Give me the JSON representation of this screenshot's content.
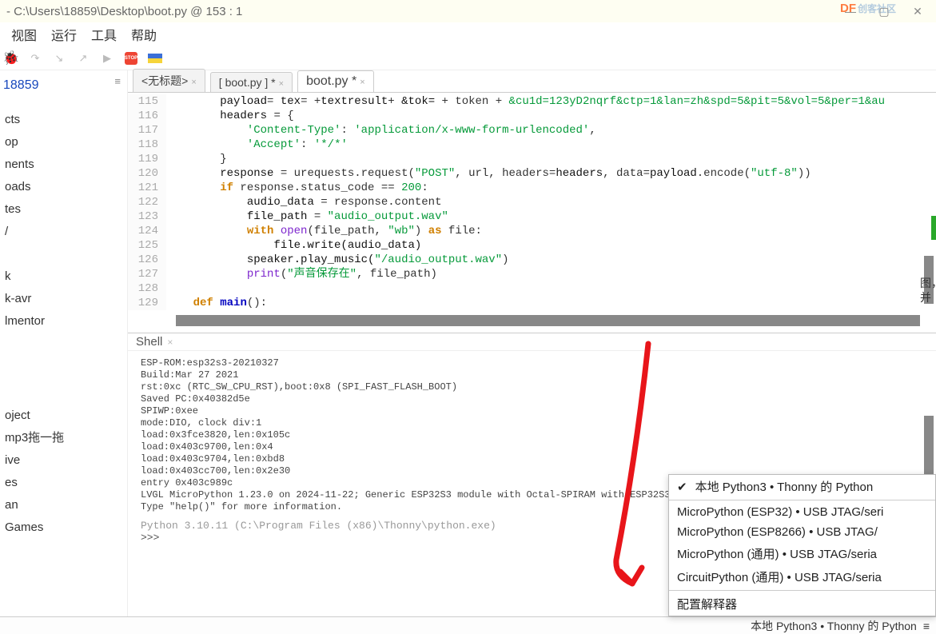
{
  "title": "- C:\\Users\\18859\\Desktop\\boot.py  @  153 : 1",
  "window": {
    "min": "—",
    "max": "▢",
    "close": "✕"
  },
  "df_brand": {
    "text": "DF",
    "sub": "创客社区"
  },
  "menu": {
    "view": "视图",
    "run": "运行",
    "tools": "工具",
    "help": "帮助"
  },
  "tabs": {
    "t1": "<无标题>",
    "t2": "[ boot.py ] *",
    "t3": "boot.py *"
  },
  "sidebar": {
    "root": "18859",
    "items": [
      "cts",
      "op",
      "nents",
      "oads",
      "tes",
      "/",
      "k",
      "k-avr",
      "lmentor",
      "oject",
      "mp3拖一拖",
      "ive",
      "es",
      "an",
      "Games"
    ]
  },
  "code": {
    "lines": [
      {
        "n": "115",
        "ind": "        ",
        "seg": [
          [
            "nm",
            "payload"
          ],
          [
            "op",
            "= "
          ],
          [
            "nm",
            "tex"
          ],
          [
            "op",
            "= +"
          ],
          [
            "nm",
            "textresult"
          ],
          [
            "op",
            "+ "
          ],
          [
            "nm",
            "&tok="
          ],
          [
            "op",
            " + token + "
          ],
          [
            "str",
            "&cu1d=123yD2nqrf&ctp=1&lan=zh&spd=5&pit=5&vol=5&per=1&au"
          ]
        ]
      },
      {
        "n": "116",
        "ind": "        ",
        "seg": [
          [
            "nm",
            "headers "
          ],
          [
            "op",
            "= {"
          ]
        ]
      },
      {
        "n": "117",
        "ind": "            ",
        "seg": [
          [
            "str",
            "'Content-Type'"
          ],
          [
            "op",
            ": "
          ],
          [
            "str",
            "'application/x-www-form-urlencoded'"
          ],
          [
            "op",
            ","
          ]
        ]
      },
      {
        "n": "118",
        "ind": "            ",
        "seg": [
          [
            "str",
            "'Accept'"
          ],
          [
            "op",
            ": "
          ],
          [
            "str",
            "'*/*'"
          ]
        ]
      },
      {
        "n": "119",
        "ind": "        ",
        "seg": [
          [
            "op",
            "}"
          ]
        ]
      },
      {
        "n": "120",
        "ind": "        ",
        "seg": [
          [
            "nm",
            "response "
          ],
          [
            "op",
            "= urequests.request("
          ],
          [
            "str",
            "\"POST\""
          ],
          [
            "op",
            ", url, headers"
          ],
          [
            "op",
            "="
          ],
          [
            "nm",
            "headers"
          ],
          [
            "op",
            ", data"
          ],
          [
            "op",
            "="
          ],
          [
            "nm",
            "payload"
          ],
          [
            "op",
            ".encode("
          ],
          [
            "str",
            "\"utf-8\""
          ],
          [
            "op",
            "))"
          ]
        ]
      },
      {
        "n": "121",
        "ind": "        ",
        "seg": [
          [
            "kw2",
            "if"
          ],
          [
            "op",
            " response.status_code "
          ],
          [
            "op",
            "== "
          ],
          [
            "num",
            "200"
          ],
          [
            "op",
            ":"
          ]
        ]
      },
      {
        "n": "122",
        "ind": "            ",
        "seg": [
          [
            "nm",
            "audio_data "
          ],
          [
            "op",
            "= response.content"
          ]
        ]
      },
      {
        "n": "123",
        "ind": "            ",
        "seg": [
          [
            "nm",
            "file_path "
          ],
          [
            "op",
            "= "
          ],
          [
            "str",
            "\"audio_output.wav\""
          ]
        ]
      },
      {
        "n": "124",
        "ind": "            ",
        "seg": [
          [
            "kw2",
            "with"
          ],
          [
            "op",
            " "
          ],
          [
            "fn",
            "open"
          ],
          [
            "op",
            "(file_path, "
          ],
          [
            "str",
            "\"wb\""
          ],
          [
            "op",
            ") "
          ],
          [
            "kw2",
            "as"
          ],
          [
            "op",
            " file:"
          ]
        ]
      },
      {
        "n": "125",
        "ind": "                ",
        "seg": [
          [
            "nm",
            "file.write(audio_data)"
          ]
        ]
      },
      {
        "n": "126",
        "ind": "            ",
        "seg": [
          [
            "nm",
            "speaker.play_music("
          ],
          [
            "str",
            "\"/audio_output.wav\""
          ],
          [
            "op",
            ")"
          ]
        ]
      },
      {
        "n": "127",
        "ind": "            ",
        "seg": [
          [
            "fn",
            "print"
          ],
          [
            "op",
            "("
          ],
          [
            "str",
            "\"声音保存在\""
          ],
          [
            "op",
            ", file_path)"
          ]
        ]
      },
      {
        "n": "128",
        "ind": "",
        "seg": []
      },
      {
        "n": "129",
        "ind": "    ",
        "seg": [
          [
            "kw2",
            "def"
          ],
          [
            "op",
            " "
          ],
          [
            "kw",
            "main"
          ],
          [
            "op",
            "():"
          ]
        ]
      }
    ]
  },
  "shell": {
    "title": "Shell",
    "body": "ESP-ROM:esp32s3-20210327\nBuild:Mar 27 2021\nrst:0xc (RTC_SW_CPU_RST),boot:0x8 (SPI_FAST_FLASH_BOOT)\nSaved PC:0x40382d5e\nSPIWP:0xee\nmode:DIO, clock div:1\nload:0x3fce3820,len:0x105c\nload:0x403c9700,len:0x4\nload:0x403c9704,len:0xbd8\nload:0x403cc700,len:0x2e30\nentry 0x403c989c\nLVGL MicroPython 1.23.0 on 2024-11-22; Generic ESP32S3 module with Octal-SPIRAM with ESP32S3\nType \"help()\" for more information.",
    "footer": "Python 3.10.11 (C:\\Program Files (x86)\\Thonny\\python.exe)",
    "prompt": ">>>"
  },
  "status": {
    "text": "本地 Python3  •  Thonny 的 Python",
    "burger": "≡"
  },
  "interpreter_menu": {
    "items": [
      {
        "label": "本地 Python3  •  Thonny 的 Python",
        "sel": true
      },
      {
        "label": "MicroPython (ESP32)  •  USB JTAG/seri"
      },
      {
        "label": "MicroPython (ESP8266)  •  USB JTAG/"
      },
      {
        "label": "MicroPython (通用)  •  USB JTAG/seria"
      },
      {
        "label": "CircuitPython (通用)  •  USB JTAG/seria"
      }
    ],
    "configure": "配置解释器"
  },
  "cjk_side": "图，\n\n并"
}
